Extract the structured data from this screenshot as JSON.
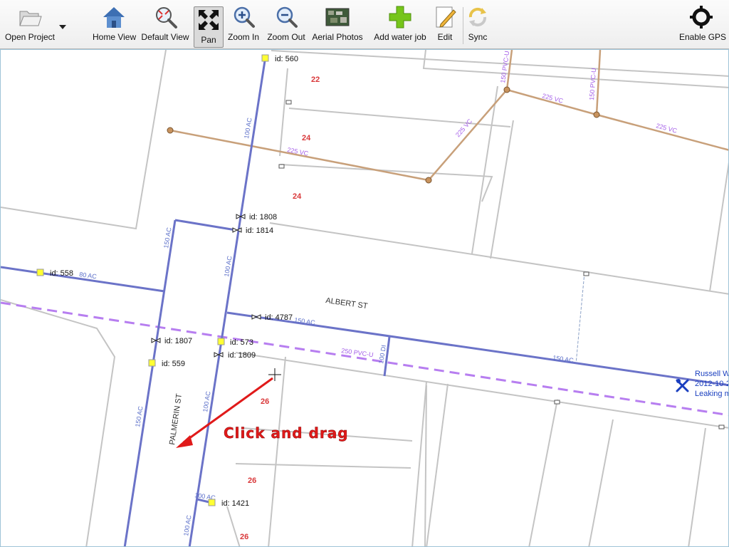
{
  "toolbar": {
    "open_project": "Open Project",
    "home_view": "Home View",
    "default_view": "Default View",
    "pan": "Pan",
    "zoom_in": "Zoom In",
    "zoom_out": "Zoom Out",
    "aerial_photos": "Aerial Photos",
    "add_water_job": "Add water job",
    "edit": "Edit",
    "sync": "Sync",
    "enable_gps": "Enable GPS"
  },
  "map": {
    "streets": {
      "albert": "ALBERT ST",
      "palmerin": "PALMERIN ST"
    },
    "lot_numbers": {
      "a": "22",
      "b": "24",
      "c": "24",
      "d": "26",
      "e": "26",
      "f": "26"
    },
    "nodes": {
      "n560": "id: 560",
      "n558": "id: 558",
      "n573": "id: 573",
      "n559": "id: 559",
      "n1421": "id: 1421"
    },
    "valves": {
      "v1808": "id: 1808",
      "v1814": "id: 1814",
      "v4787": "id: 4787",
      "v1807": "id: 1807",
      "v1809": "id: 1809"
    },
    "pipe_labels": {
      "p1": "100 AC",
      "p2": "150 AC",
      "p3": "100 AC",
      "p4": "80 AC",
      "p5": "150 AC",
      "p6": "150 AC",
      "p7": "100 AC",
      "p8": "150 AC",
      "p9": "100 AC",
      "p10": "100 AC",
      "p11": "100 DI",
      "p12": "250 PVC-U",
      "p13": "225 VC",
      "p14": "225 VC",
      "p15": "225 VC",
      "p16": "225 VC",
      "p17": "150 PVC-U",
      "p18": "150 PVC-U"
    },
    "water_job": {
      "line1": "Russell W",
      "line2": "2012-10-2",
      "line3": "Leaking m"
    },
    "annotation": "Click and drag"
  },
  "colors": {
    "water_main": "#6b73c8",
    "sewer": "#c8a07a",
    "pvc_dashed": "#b77ef0",
    "lot_number": "#d9383a",
    "annotation": "#e01a1a",
    "node": "#ffff33"
  }
}
